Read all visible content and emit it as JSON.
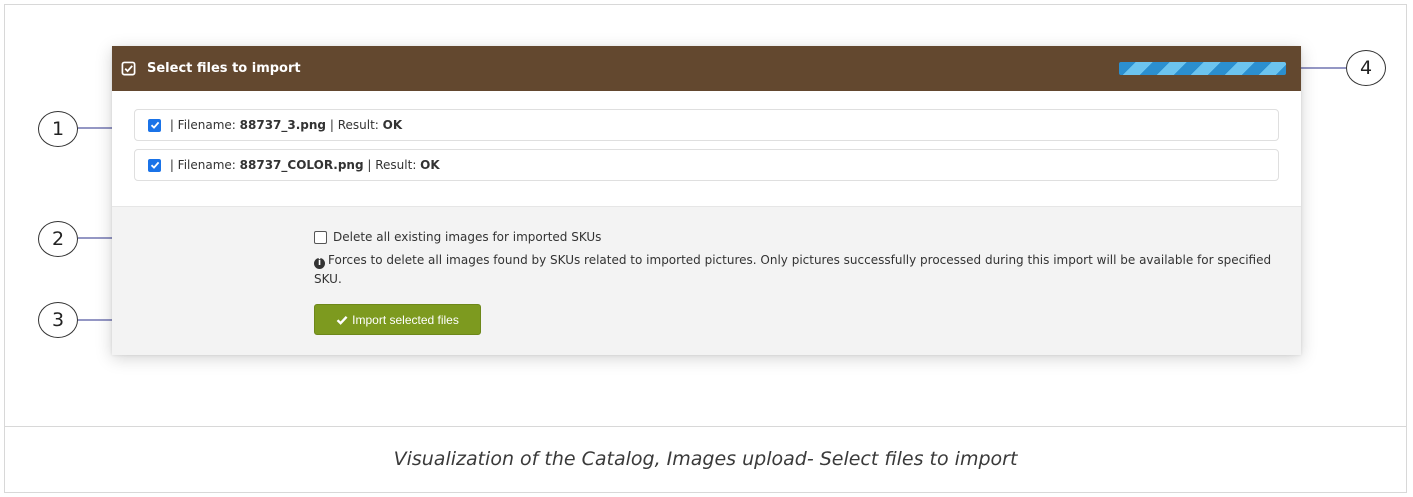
{
  "panel": {
    "title": "Select files to import",
    "progress": 1.0,
    "files": [
      {
        "checked": true,
        "prefix": " | Filename: ",
        "filename": "88737_3.png",
        "middle": " | Result: ",
        "result": "OK"
      },
      {
        "checked": true,
        "prefix": " | Filename: ",
        "filename": "88737_COLOR.png",
        "middle": " | Result: ",
        "result": "OK"
      }
    ],
    "delete_option": {
      "checked": false,
      "label": "Delete all existing images for imported SKUs"
    },
    "info_text": "Forces to delete all images found by SKUs related to imported pictures. Only pictures successfully processed during this import will be available for specified SKU.",
    "import_button": "Import selected files"
  },
  "callouts": [
    "1",
    "2",
    "3",
    "4"
  ],
  "caption": "Visualization of the Catalog, Images upload- Select files to import",
  "colors": {
    "header": "#63482f",
    "progress": "#2b8fcf",
    "button": "#7d9a1f",
    "checkbox": "#1a73e8"
  },
  "icons": {
    "header": "checkbox-square-icon",
    "info": "info-circle-icon",
    "button": "checkmark-icon"
  }
}
